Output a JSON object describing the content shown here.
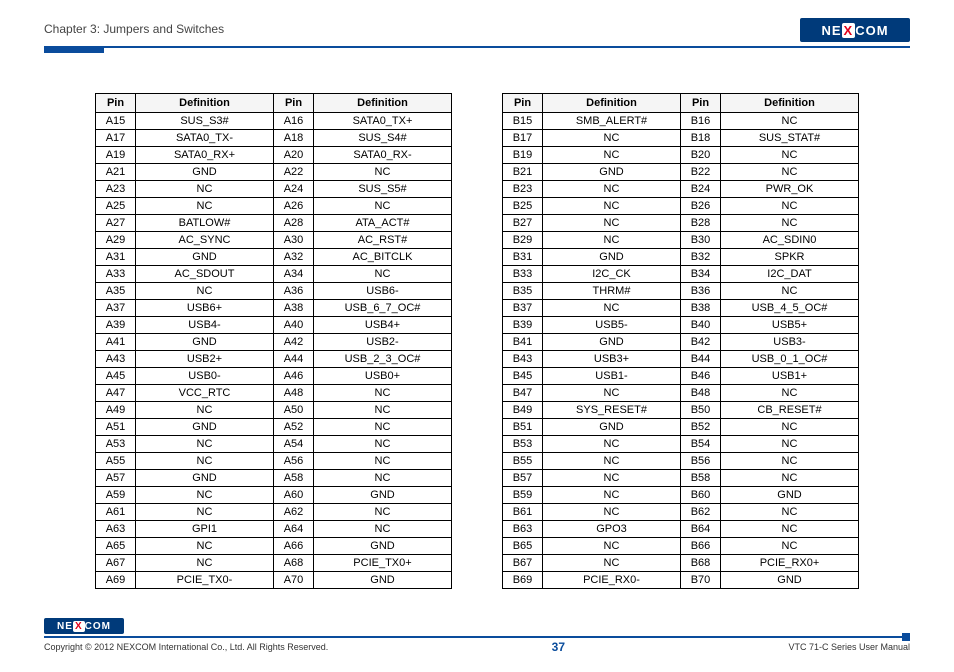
{
  "header": {
    "chapter": "Chapter 3: Jumpers and Switches",
    "logo_ne": "NE",
    "logo_x": "X",
    "logo_com": "COM"
  },
  "table_headers": {
    "pin": "Pin",
    "definition": "Definition"
  },
  "table_left": [
    {
      "p1": "A15",
      "d1": "SUS_S3#",
      "p2": "A16",
      "d2": "SATA0_TX+"
    },
    {
      "p1": "A17",
      "d1": "SATA0_TX-",
      "p2": "A18",
      "d2": "SUS_S4#"
    },
    {
      "p1": "A19",
      "d1": "SATA0_RX+",
      "p2": "A20",
      "d2": "SATA0_RX-"
    },
    {
      "p1": "A21",
      "d1": "GND",
      "p2": "A22",
      "d2": "NC"
    },
    {
      "p1": "A23",
      "d1": "NC",
      "p2": "A24",
      "d2": "SUS_S5#"
    },
    {
      "p1": "A25",
      "d1": "NC",
      "p2": "A26",
      "d2": "NC"
    },
    {
      "p1": "A27",
      "d1": "BATLOW#",
      "p2": "A28",
      "d2": "ATA_ACT#"
    },
    {
      "p1": "A29",
      "d1": "AC_SYNC",
      "p2": "A30",
      "d2": "AC_RST#"
    },
    {
      "p1": "A31",
      "d1": "GND",
      "p2": "A32",
      "d2": "AC_BITCLK"
    },
    {
      "p1": "A33",
      "d1": "AC_SDOUT",
      "p2": "A34",
      "d2": "NC"
    },
    {
      "p1": "A35",
      "d1": "NC",
      "p2": "A36",
      "d2": "USB6-"
    },
    {
      "p1": "A37",
      "d1": "USB6+",
      "p2": "A38",
      "d2": "USB_6_7_OC#"
    },
    {
      "p1": "A39",
      "d1": "USB4-",
      "p2": "A40",
      "d2": "USB4+"
    },
    {
      "p1": "A41",
      "d1": "GND",
      "p2": "A42",
      "d2": "USB2-"
    },
    {
      "p1": "A43",
      "d1": "USB2+",
      "p2": "A44",
      "d2": "USB_2_3_OC#"
    },
    {
      "p1": "A45",
      "d1": "USB0-",
      "p2": "A46",
      "d2": "USB0+"
    },
    {
      "p1": "A47",
      "d1": "VCC_RTC",
      "p2": "A48",
      "d2": "NC"
    },
    {
      "p1": "A49",
      "d1": "NC",
      "p2": "A50",
      "d2": "NC"
    },
    {
      "p1": "A51",
      "d1": "GND",
      "p2": "A52",
      "d2": "NC"
    },
    {
      "p1": "A53",
      "d1": "NC",
      "p2": "A54",
      "d2": "NC"
    },
    {
      "p1": "A55",
      "d1": "NC",
      "p2": "A56",
      "d2": "NC"
    },
    {
      "p1": "A57",
      "d1": "GND",
      "p2": "A58",
      "d2": "NC"
    },
    {
      "p1": "A59",
      "d1": "NC",
      "p2": "A60",
      "d2": "GND"
    },
    {
      "p1": "A61",
      "d1": "NC",
      "p2": "A62",
      "d2": "NC"
    },
    {
      "p1": "A63",
      "d1": "GPI1",
      "p2": "A64",
      "d2": "NC"
    },
    {
      "p1": "A65",
      "d1": "NC",
      "p2": "A66",
      "d2": "GND"
    },
    {
      "p1": "A67",
      "d1": "NC",
      "p2": "A68",
      "d2": "PCIE_TX0+"
    },
    {
      "p1": "A69",
      "d1": "PCIE_TX0-",
      "p2": "A70",
      "d2": "GND"
    }
  ],
  "table_right": [
    {
      "p1": "B15",
      "d1": "SMB_ALERT#",
      "p2": "B16",
      "d2": "NC"
    },
    {
      "p1": "B17",
      "d1": "NC",
      "p2": "B18",
      "d2": "SUS_STAT#"
    },
    {
      "p1": "B19",
      "d1": "NC",
      "p2": "B20",
      "d2": "NC"
    },
    {
      "p1": "B21",
      "d1": "GND",
      "p2": "B22",
      "d2": "NC"
    },
    {
      "p1": "B23",
      "d1": "NC",
      "p2": "B24",
      "d2": "PWR_OK"
    },
    {
      "p1": "B25",
      "d1": "NC",
      "p2": "B26",
      "d2": "NC"
    },
    {
      "p1": "B27",
      "d1": "NC",
      "p2": "B28",
      "d2": "NC"
    },
    {
      "p1": "B29",
      "d1": "NC",
      "p2": "B30",
      "d2": "AC_SDIN0"
    },
    {
      "p1": "B31",
      "d1": "GND",
      "p2": "B32",
      "d2": "SPKR"
    },
    {
      "p1": "B33",
      "d1": "I2C_CK",
      "p2": "B34",
      "d2": "I2C_DAT"
    },
    {
      "p1": "B35",
      "d1": "THRM#",
      "p2": "B36",
      "d2": "NC"
    },
    {
      "p1": "B37",
      "d1": "NC",
      "p2": "B38",
      "d2": "USB_4_5_OC#"
    },
    {
      "p1": "B39",
      "d1": "USB5-",
      "p2": "B40",
      "d2": "USB5+"
    },
    {
      "p1": "B41",
      "d1": "GND",
      "p2": "B42",
      "d2": "USB3-"
    },
    {
      "p1": "B43",
      "d1": "USB3+",
      "p2": "B44",
      "d2": "USB_0_1_OC#"
    },
    {
      "p1": "B45",
      "d1": "USB1-",
      "p2": "B46",
      "d2": "USB1+"
    },
    {
      "p1": "B47",
      "d1": "NC",
      "p2": "B48",
      "d2": "NC"
    },
    {
      "p1": "B49",
      "d1": "SYS_RESET#",
      "p2": "B50",
      "d2": "CB_RESET#"
    },
    {
      "p1": "B51",
      "d1": "GND",
      "p2": "B52",
      "d2": "NC"
    },
    {
      "p1": "B53",
      "d1": "NC",
      "p2": "B54",
      "d2": "NC"
    },
    {
      "p1": "B55",
      "d1": "NC",
      "p2": "B56",
      "d2": "NC"
    },
    {
      "p1": "B57",
      "d1": "NC",
      "p2": "B58",
      "d2": "NC"
    },
    {
      "p1": "B59",
      "d1": "NC",
      "p2": "B60",
      "d2": "GND"
    },
    {
      "p1": "B61",
      "d1": "NC",
      "p2": "B62",
      "d2": "NC"
    },
    {
      "p1": "B63",
      "d1": "GPO3",
      "p2": "B64",
      "d2": "NC"
    },
    {
      "p1": "B65",
      "d1": "NC",
      "p2": "B66",
      "d2": "NC"
    },
    {
      "p1": "B67",
      "d1": "NC",
      "p2": "B68",
      "d2": "PCIE_RX0+"
    },
    {
      "p1": "B69",
      "d1": "PCIE_RX0-",
      "p2": "B70",
      "d2": "GND"
    }
  ],
  "footer": {
    "copyright": "Copyright © 2012 NEXCOM International Co., Ltd. All Rights Reserved.",
    "page": "37",
    "manual": "VTC 71-C Series User Manual"
  }
}
